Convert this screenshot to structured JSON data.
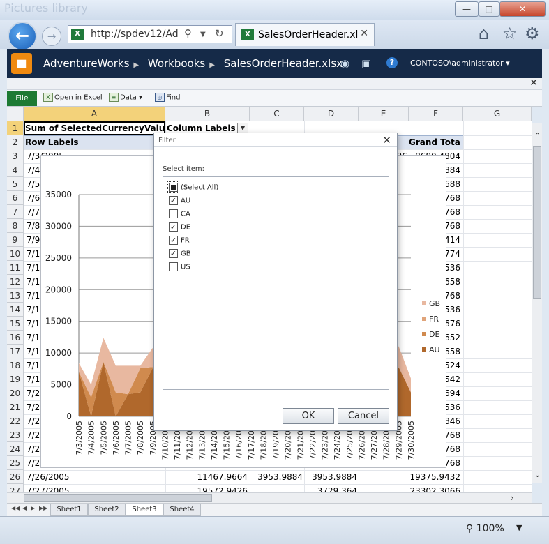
{
  "browser": {
    "ghost_title": "Pictures library",
    "url": "http://spdev12/Ad",
    "tab_title": "SalesOrderHeader.xlsx",
    "minimize_icon": "minimize-icon",
    "maximize_icon": "maximize-icon",
    "close_icon": "close-icon"
  },
  "sharepoint": {
    "breadcrumbs": [
      "AdventureWorks",
      "Workbooks",
      "SalesOrderHeader.xlsx"
    ],
    "user": "CONTOSO\\administrator ▾",
    "help": "?"
  },
  "ribbon": {
    "file": "File",
    "open_in_excel": "Open in Excel",
    "data": "Data ▾",
    "find": "Find"
  },
  "sheet": {
    "columns": [
      "A",
      "B",
      "C",
      "D",
      "E",
      "F",
      "G"
    ],
    "rows": [
      "1",
      "2",
      "3",
      "4",
      "5",
      "6",
      "7",
      "8",
      "9",
      "10",
      "11",
      "12",
      "13",
      "14",
      "15",
      "16",
      "17",
      "18",
      "19",
      "20",
      "21",
      "22",
      "23",
      "24",
      "25",
      "26",
      "27"
    ],
    "a1": "Sum of SelectedCurrencyValue",
    "b1": "Column Labels",
    "a2": "Row Labels",
    "f2": "Grand Total",
    "row_labels": [
      "7/3/2005",
      "7/4/",
      "7/5/",
      "7/6/",
      "7/7/",
      "7/8/",
      "7/9/",
      "7/10/",
      "7/11/",
      "7/12/",
      "7/13/",
      "7/14/",
      "7/15/",
      "7/16/",
      "7/17/",
      "7/18/",
      "7/19/",
      "7/20/",
      "7/21/",
      "7/22/",
      "7/23/",
      "7/24/",
      "7/25/",
      "7/26/2005",
      "7/27/2005"
    ],
    "e3_fragment": "26",
    "grand_totals": [
      "8680.4804",
      "884",
      "688",
      "768",
      "768",
      "768",
      "414",
      "774",
      "536",
      "658",
      "768",
      "536",
      "676",
      "652",
      "658",
      "524",
      "542",
      "694",
      "536",
      "846",
      "768",
      "768",
      "768",
      "19375.9432",
      "23302.3066"
    ],
    "row26": {
      "b": "11467.9664",
      "c": "3953.9884",
      "d": "3953.9884"
    },
    "row27": {
      "b": "19572.9426",
      "d": "3729.364"
    }
  },
  "chart_data": {
    "type": "area",
    "stacked": true,
    "categories": [
      "7/3/2005",
      "7/4/2005",
      "7/5/2005",
      "7/6/2005",
      "7/7/2005",
      "7/8/2005",
      "7/9/2005",
      "7/10/2005",
      "7/11/2005",
      "7/12/2005",
      "7/13/2005",
      "7/14/2005",
      "7/15/2005",
      "7/16/2005",
      "7/17/2005",
      "7/18/2005",
      "7/19/2005",
      "7/20/2005",
      "7/21/2005",
      "7/22/2005",
      "7/23/2005",
      "7/24/2005",
      "7/25/2005",
      "7/26/2005",
      "7/27/2005",
      "7/28/2005",
      "7/29/2005",
      "7/30/2005"
    ],
    "ylim": [
      0,
      35000
    ],
    "yticks": [
      "0",
      "5000",
      "10000",
      "15000",
      "20000",
      "25000",
      "30000",
      "35000"
    ],
    "legend_position": "right",
    "series": [
      {
        "name": "AU",
        "color": "#b0682c",
        "values": [
          7000,
          0,
          8600,
          0,
          3500,
          3800,
          7600,
          0,
          0,
          0,
          0,
          0,
          0,
          0,
          0,
          0,
          0,
          0,
          0,
          0,
          0,
          0,
          0,
          0,
          0,
          0,
          7800,
          3800
        ]
      },
      {
        "name": "DE",
        "color": "#d08a4e",
        "values": [
          0,
          3000,
          0,
          3800,
          0,
          3800,
          200,
          0,
          0,
          0,
          0,
          0,
          0,
          0,
          0,
          0,
          0,
          0,
          0,
          0,
          0,
          0,
          0,
          0,
          0,
          0,
          0,
          0
        ]
      },
      {
        "name": "FR",
        "color": "#e0a47a",
        "values": [
          0,
          0,
          0,
          0,
          0,
          0,
          0,
          0,
          0,
          0,
          0,
          0,
          0,
          0,
          0,
          0,
          0,
          0,
          0,
          0,
          0,
          0,
          0,
          0,
          0,
          0,
          0,
          0
        ]
      },
      {
        "name": "GB",
        "color": "#e8b8a0",
        "values": [
          1400,
          2000,
          3800,
          4200,
          4500,
          400,
          3000,
          0,
          0,
          0,
          0,
          0,
          0,
          0,
          0,
          0,
          0,
          0,
          0,
          0,
          0,
          0,
          0,
          0,
          0,
          0,
          3300,
          2200
        ]
      }
    ]
  },
  "filter_dialog": {
    "title": "Filter",
    "prompt": "Select item:",
    "items": [
      {
        "label": "(Select All)",
        "state": "partial"
      },
      {
        "label": "AU",
        "state": "checked"
      },
      {
        "label": "CA",
        "state": "unchecked"
      },
      {
        "label": "DE",
        "state": "checked"
      },
      {
        "label": "FR",
        "state": "checked"
      },
      {
        "label": "GB",
        "state": "checked"
      },
      {
        "label": "US",
        "state": "unchecked"
      }
    ],
    "ok": "OK",
    "cancel": "Cancel"
  },
  "sheet_tabs": [
    "Sheet1",
    "Sheet2",
    "Sheet3",
    "Sheet4"
  ],
  "active_sheet": "Sheet3",
  "status": {
    "zoom": "100%"
  }
}
